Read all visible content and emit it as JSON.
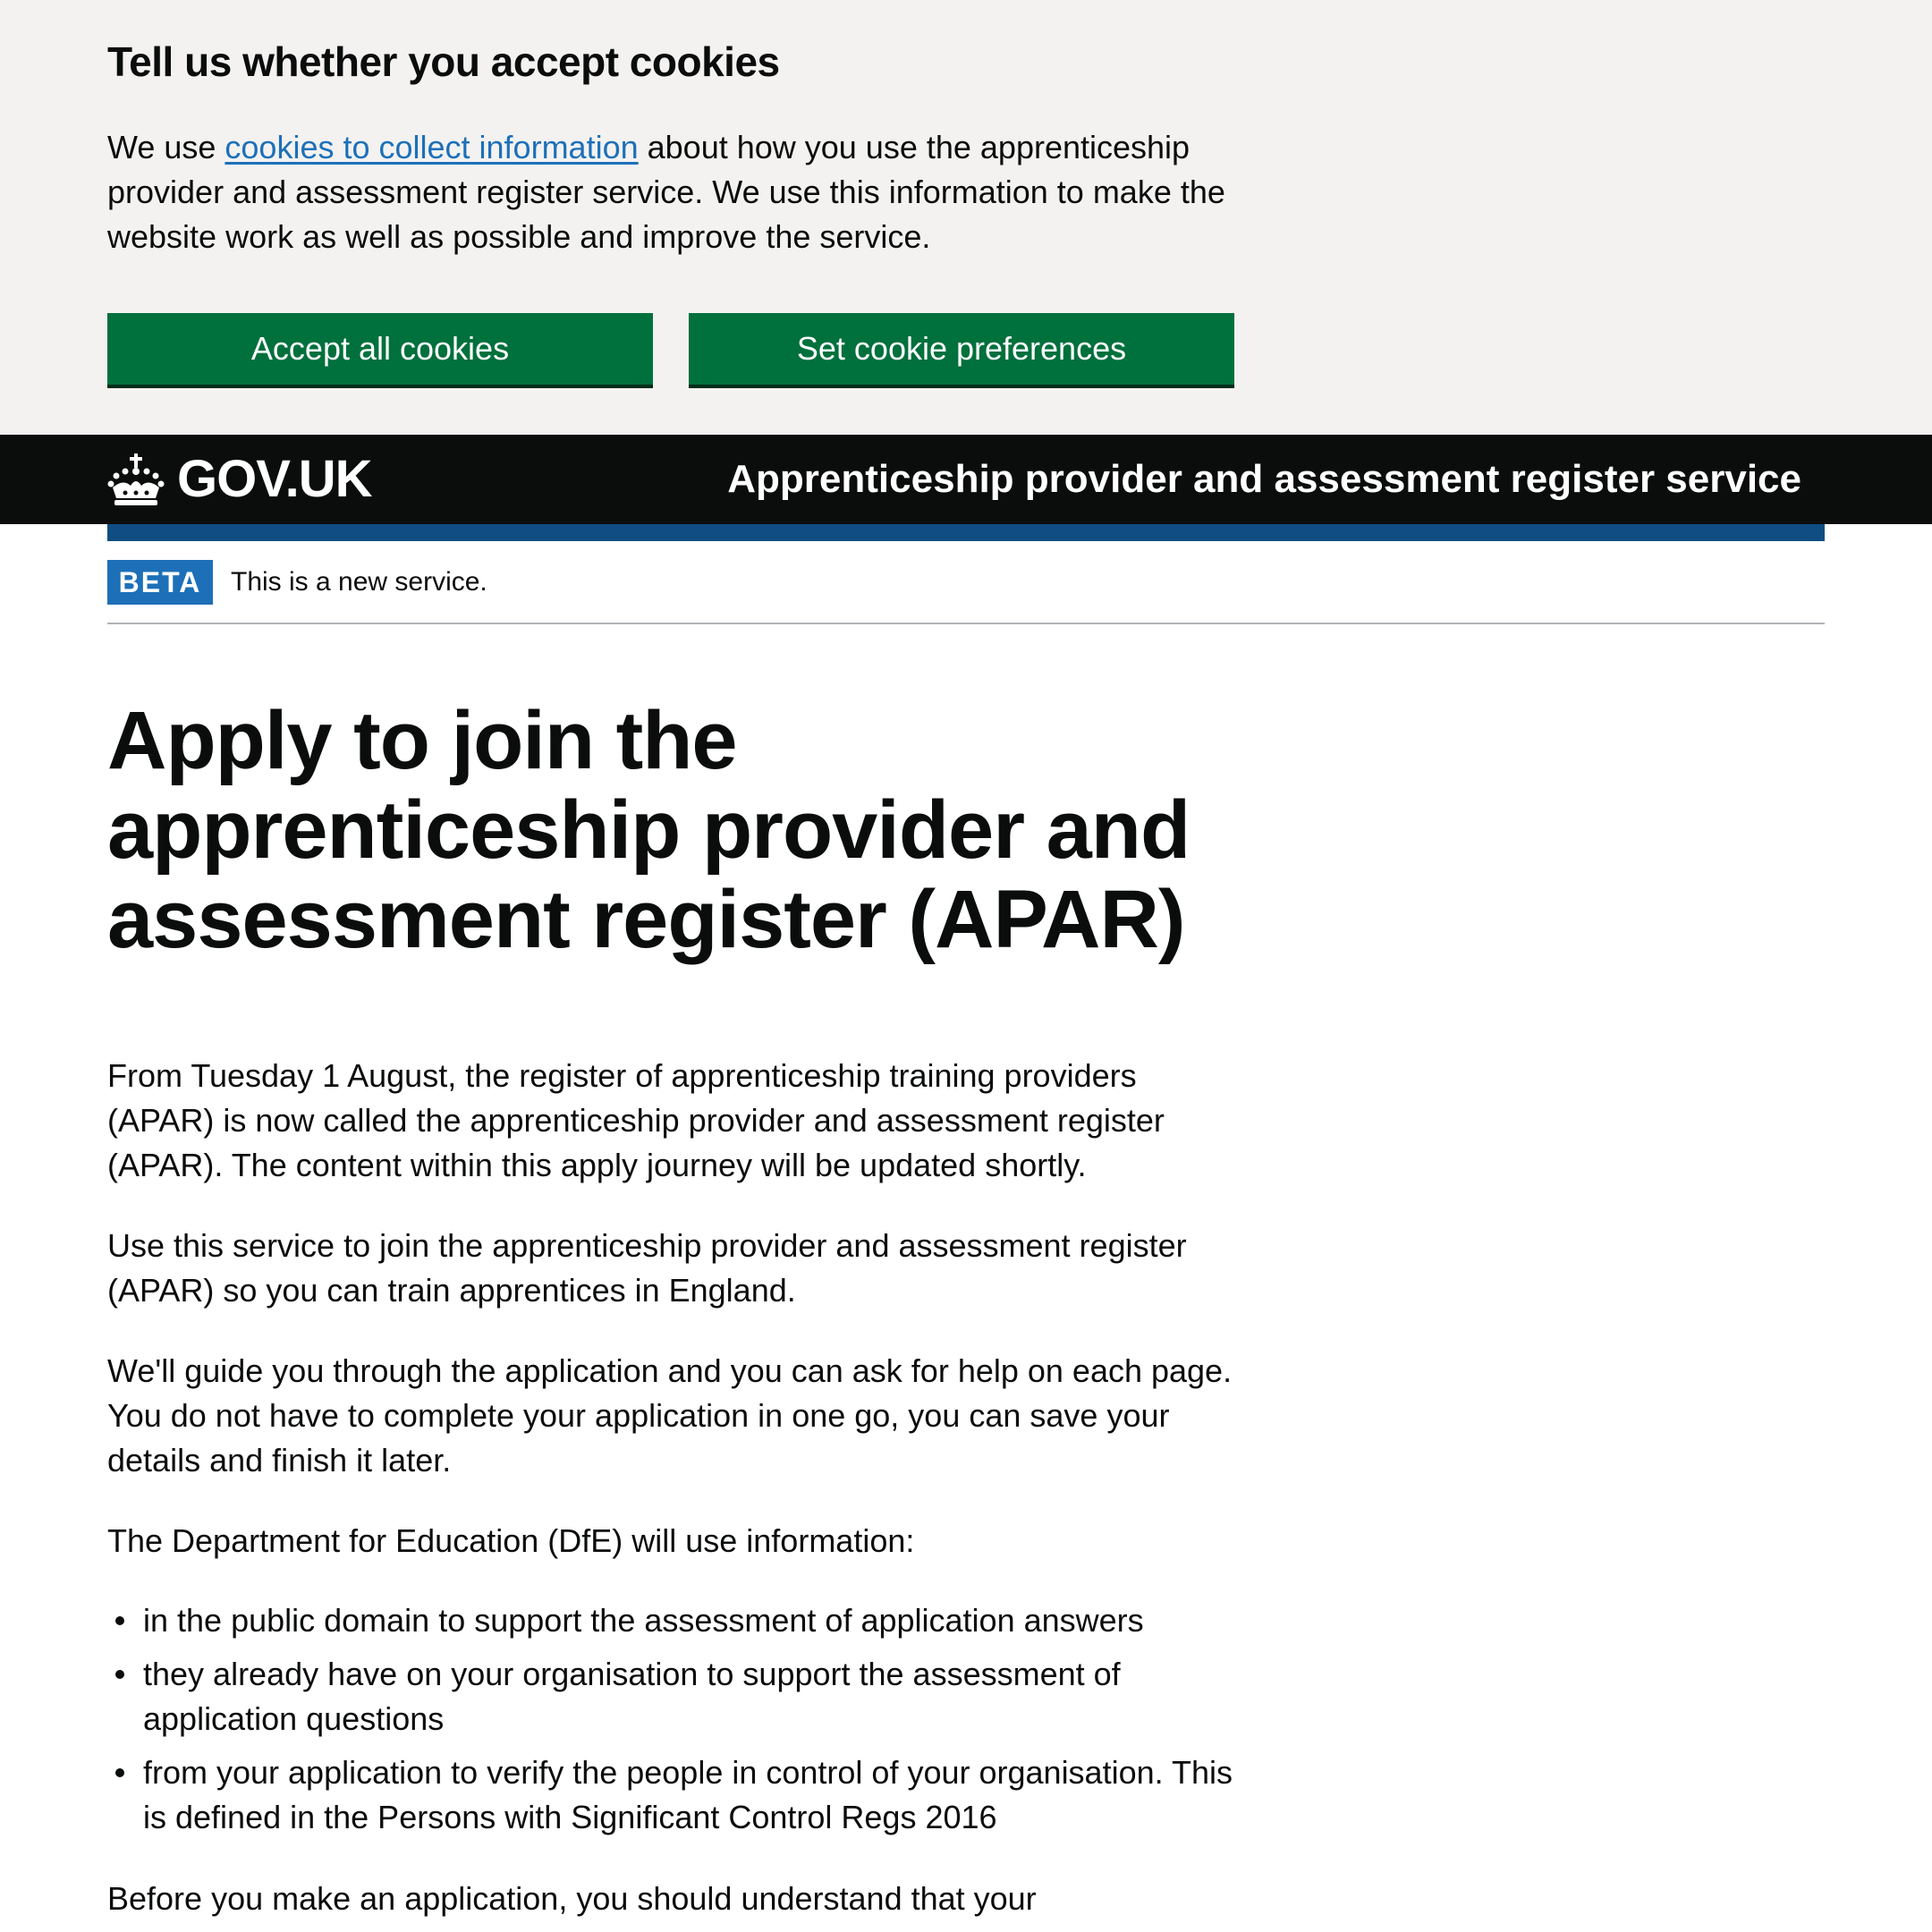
{
  "cookie_banner": {
    "heading": "Tell us whether you accept cookies",
    "text_before_link": "We use ",
    "link_text": "cookies to collect information",
    "text_after_link": " about how you use the apprenticeship provider and assessment register service. We use this information to make the website work as well as possible and improve the service.",
    "accept_label": "Accept all cookies",
    "preferences_label": "Set cookie preferences"
  },
  "header": {
    "logo_text": "GOV.UK",
    "service_name": "Apprenticeship provider and assessment register service"
  },
  "phase_banner": {
    "tag": "BETA",
    "text": "This is a new service."
  },
  "main": {
    "title": "Apply to join the apprenticeship provider and assessment register (APAR)",
    "paragraphs": [
      "From Tuesday 1 August, the register of apprenticeship training providers (APAR) is now called the apprenticeship provider and assessment register (APAR). The content within this apply journey will be updated shortly.",
      "Use this service to join the apprenticeship provider and assessment register (APAR) so you can train apprentices in England.",
      "We'll guide you through the application and you can ask for help on each page. You do not have to complete your application in one go, you can save your details and finish it later.",
      "The Department for Education (DfE) will use information:",
      "Before you make an application, you should understand that your"
    ],
    "bullets": [
      "in the public domain to support the assessment of application answers",
      "they already have on your organisation to support the assessment of application questions",
      "from your application to verify the people in control of your organisation. This is defined in the Persons with Significant Control Regs 2016"
    ]
  },
  "colors": {
    "banner_background": "#f3f2f1",
    "button_green": "#00703c",
    "header_black": "#0b0c0c",
    "link_blue": "#1d70b8",
    "header_underline": "#0f4d82"
  }
}
